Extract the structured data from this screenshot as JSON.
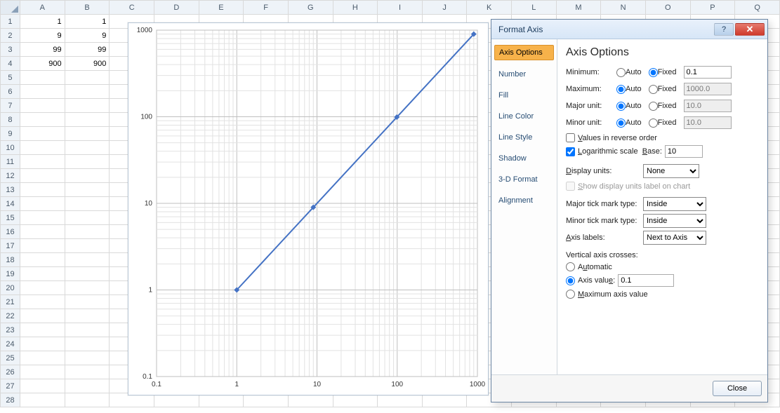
{
  "columns": [
    "A",
    "B",
    "C",
    "D",
    "E",
    "F",
    "G",
    "H",
    "I",
    "J",
    "K",
    "L",
    "M",
    "N",
    "O",
    "P",
    "Q"
  ],
  "rows": 28,
  "cells": {
    "A1": "1",
    "B1": "1",
    "A2": "9",
    "B2": "9",
    "A3": "99",
    "B3": "99",
    "A4": "900",
    "B4": "900"
  },
  "chart_data": {
    "type": "line",
    "x": [
      1,
      9,
      99,
      900
    ],
    "y": [
      1,
      9,
      99,
      900
    ],
    "x_ticks": [
      0.1,
      1,
      10,
      100,
      1000
    ],
    "y_ticks": [
      0.1,
      1,
      10,
      100,
      1000
    ],
    "x_scale": "log",
    "y_scale": "log",
    "xlim": [
      0.1,
      1000
    ],
    "ylim": [
      0.1,
      1000
    ]
  },
  "dialog": {
    "title": "Format Axis",
    "nav": [
      "Axis Options",
      "Number",
      "Fill",
      "Line Color",
      "Line Style",
      "Shadow",
      "3-D Format",
      "Alignment"
    ],
    "heading": "Axis Options",
    "min_label": "Minimum:",
    "max_label": "Maximum:",
    "major_label": "Major unit:",
    "minor_label": "Minor unit:",
    "auto": "Auto",
    "fixed": "Fixed",
    "min_val": "0.1",
    "max_val": "1000.0",
    "major_val": "10.0",
    "minor_val": "10.0",
    "reverse": "Values in reverse order",
    "logscale": "Logarithmic scale",
    "base_label": "Base:",
    "base_val": "10",
    "display_units": "Display units:",
    "display_units_val": "None",
    "show_units_label": "Show display units label on chart",
    "major_tick": "Major tick mark type:",
    "minor_tick": "Minor tick mark type:",
    "tick_val": "Inside",
    "axis_labels": "Axis labels:",
    "axis_labels_val": "Next to Axis",
    "vac_heading": "Vertical axis crosses:",
    "vac_auto": "Automatic",
    "vac_axisval": "Axis value:",
    "vac_val": "0.1",
    "vac_max": "Maximum axis value",
    "close": "Close"
  }
}
